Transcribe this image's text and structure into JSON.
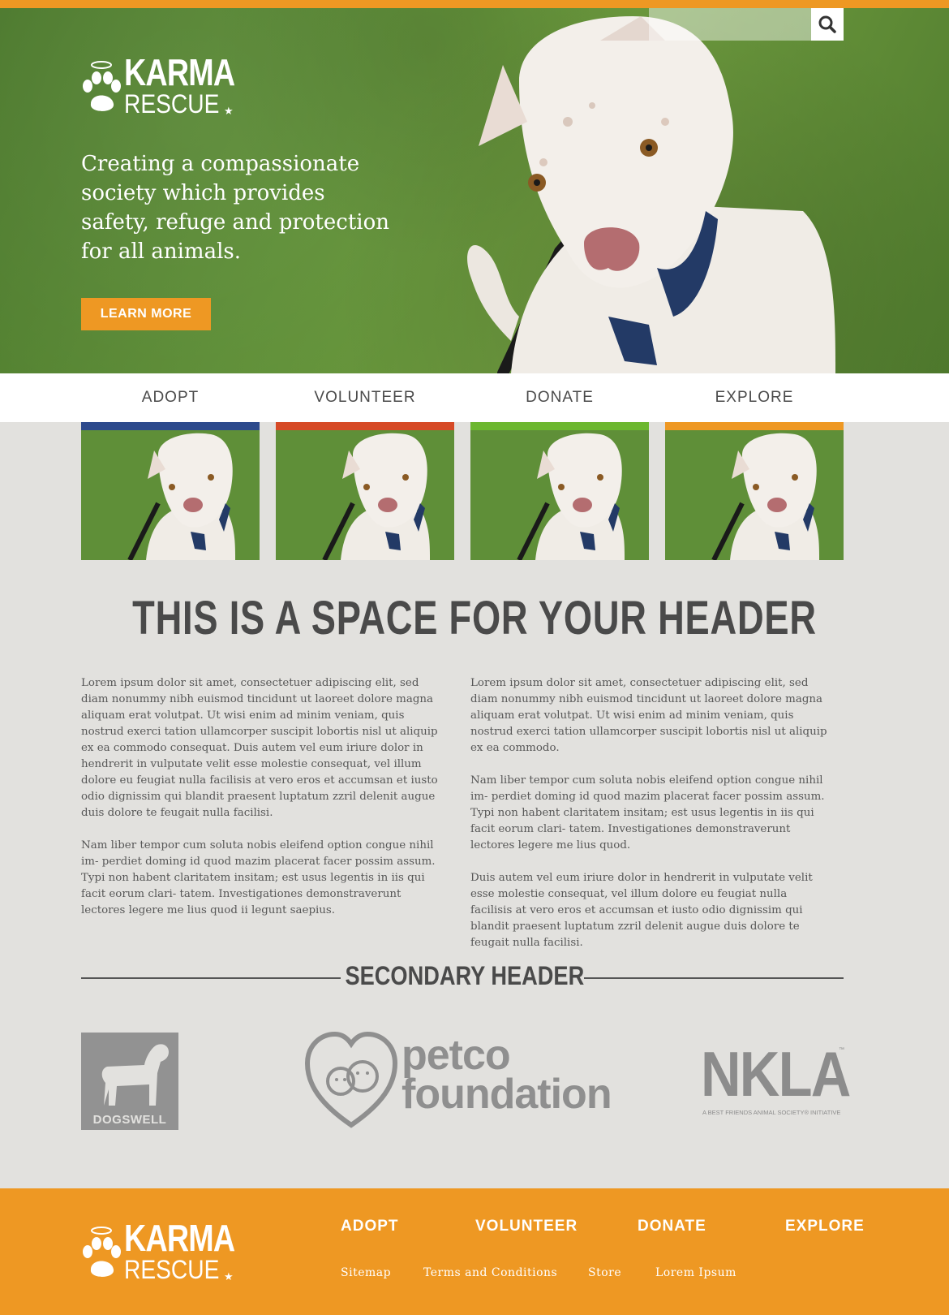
{
  "brand": {
    "name_top": "KARMA",
    "name_bottom": "RESCUE",
    "star": "★"
  },
  "search": {
    "placeholder": "",
    "icon": "search-icon"
  },
  "hero": {
    "tagline": "Creating a compassionate society which provides safety, refuge and protection for all animals.",
    "cta_label": "LEARN MORE"
  },
  "nav": [
    {
      "label": "ADOPT",
      "color": "#2d4a8c"
    },
    {
      "label": "VOLUNTEER",
      "color": "#d64a26"
    },
    {
      "label": "DONATE",
      "color": "#6cb72f"
    },
    {
      "label": "EXPLORE",
      "color": "#ee9823"
    }
  ],
  "main": {
    "header": "THIS IS A SPACE FOR YOUR HEADER",
    "col1": [
      "Lorem ipsum dolor sit amet, consectetuer adipiscing elit, sed diam nonummy nibh euismod tincidunt ut laoreet dolore magna aliquam erat volutpat. Ut wisi enim ad minim veniam, quis nostrud exerci tation ullamcorper suscipit lobortis nisl ut aliquip ex ea commodo consequat. Duis autem vel eum iriure dolor in hendrerit in vulputate velit esse molestie consequat, vel illum dolore eu feugiat nulla facilisis at vero eros et accumsan et iusto odio dignissim qui blandit praesent luptatum zzril delenit augue duis dolore te feugait nulla facilisi.",
      "Nam liber tempor cum soluta nobis eleifend option congue nihil im- perdiet doming id quod mazim placerat facer possim assum. Typi non habent claritatem insitam; est usus legentis in iis qui facit eorum clari- tatem. Investigationes demonstraverunt lectores legere me lius quod ii legunt saepius."
    ],
    "col2": [
      "Lorem ipsum dolor sit amet, consectetuer adipiscing elit, sed diam nonummy nibh euismod tincidunt ut laoreet dolore magna aliquam erat volutpat. Ut wisi enim ad minim veniam, quis nostrud exerci tation ullamcorper suscipit lobortis nisl ut aliquip ex ea commodo.",
      "Nam liber tempor cum soluta nobis eleifend option congue nihil im- perdiet doming id quod mazim placerat facer possim assum. Typi non habent claritatem insitam; est usus legentis in iis qui facit eorum clari- tatem. Investigationes demonstraverunt lectores legere me lius quod.",
      "Duis autem vel eum iriure dolor in hendrerit in vulputate velit esse molestie consequat, vel illum dolore eu feugiat nulla facilisis at vero eros et accumsan et iusto odio dignissim qui blandit praesent luptatum zzril delenit augue duis dolore te feugait nulla facilisi."
    ]
  },
  "secondary": {
    "header": "SECONDARY HEADER",
    "partners": {
      "dogswell": "DOGSWELL",
      "petco_line1": "petco",
      "petco_line2": "foundation",
      "nkla": "NKLA",
      "nkla_tm": "™",
      "nkla_sub": "A BEST FRIENDS ANIMAL SOCIETY® INITIATIVE"
    }
  },
  "footer": {
    "nav": [
      "ADOPT",
      "VOLUNTEER",
      "DONATE",
      "EXPLORE"
    ],
    "links": [
      "Sitemap",
      "Terms and Conditions",
      "Store",
      "Lorem Ipsum"
    ]
  },
  "colors": {
    "accent": "#ee9823",
    "text": "#4a4a4a",
    "bg": "#e2e1de"
  }
}
